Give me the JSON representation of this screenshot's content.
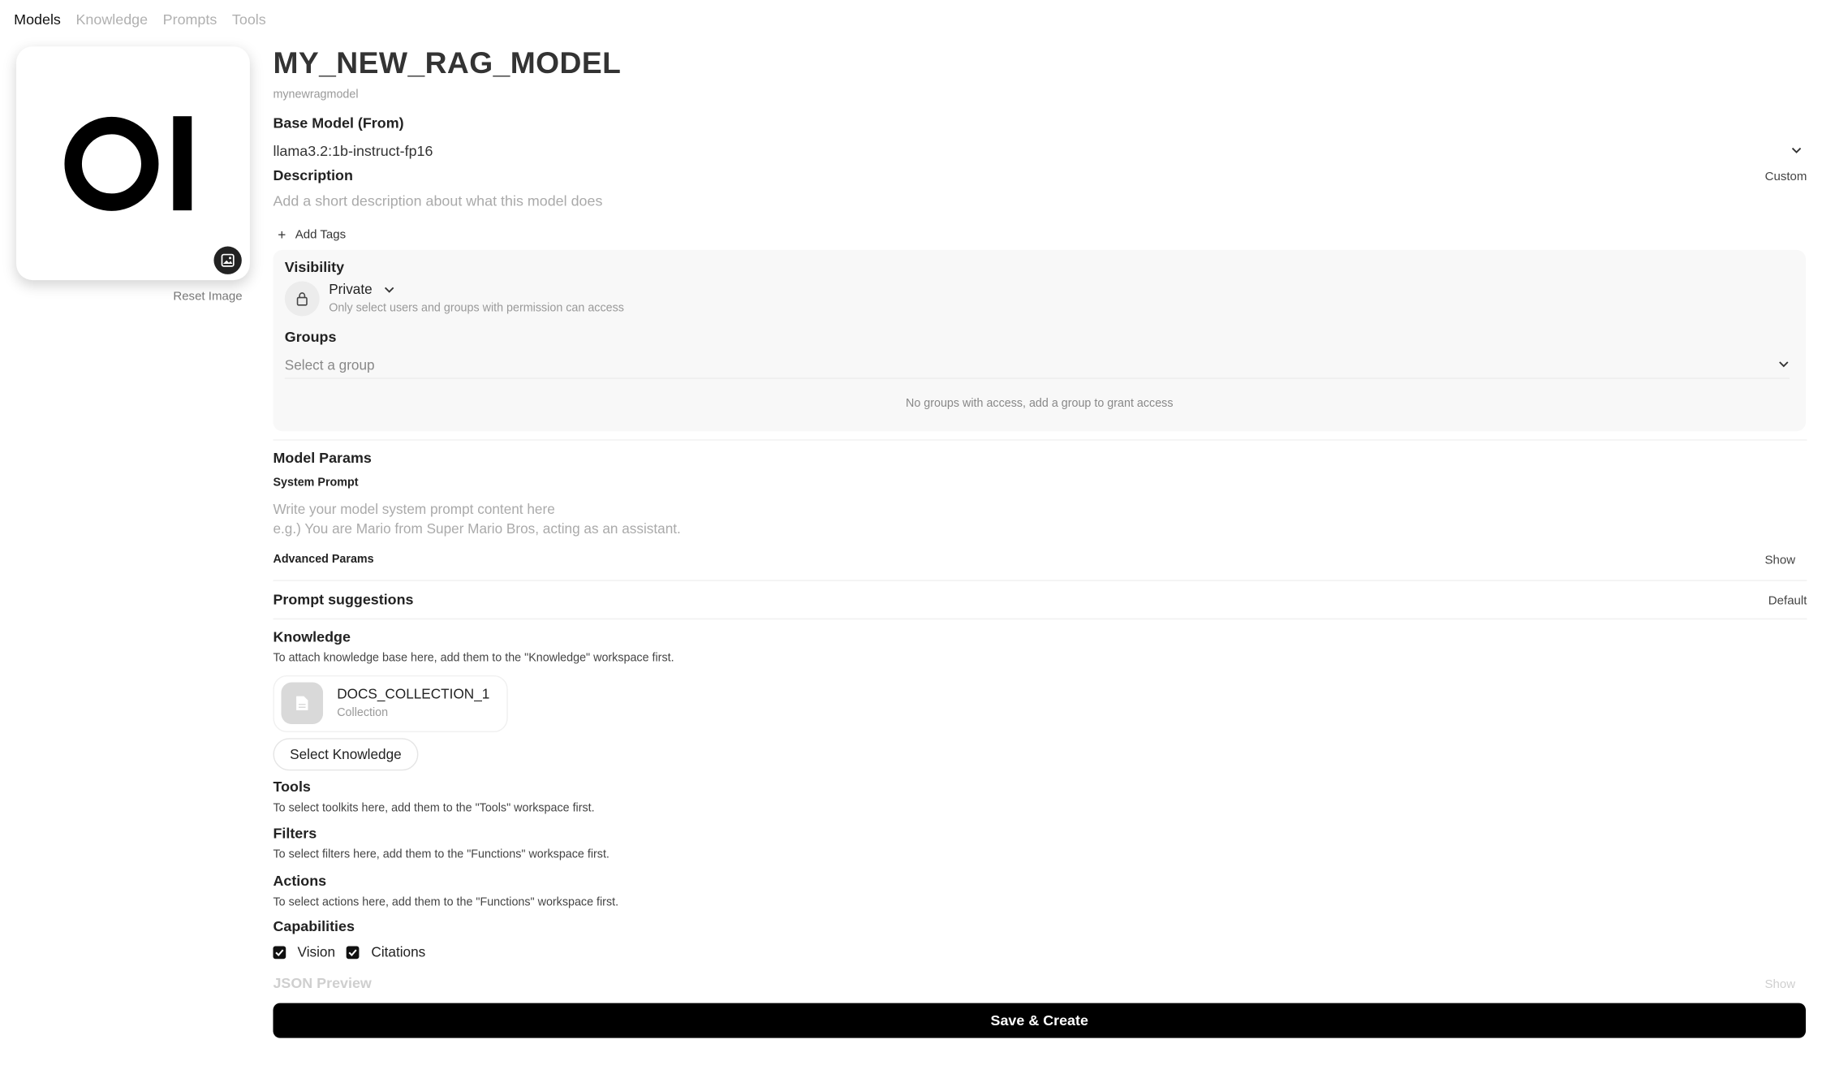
{
  "nav": {
    "tabs": [
      {
        "label": "Models",
        "active": true
      },
      {
        "label": "Knowledge",
        "active": false
      },
      {
        "label": "Prompts",
        "active": false
      },
      {
        "label": "Tools",
        "active": false
      }
    ]
  },
  "avatar": {
    "logo_text": "OI",
    "reset_label": "Reset Image"
  },
  "model": {
    "name": "MY_NEW_RAG_MODEL",
    "id": "mynewragmodel"
  },
  "base_model": {
    "label": "Base Model (From)",
    "value": "llama3.2:1b-instruct-fp16"
  },
  "description": {
    "label": "Description",
    "mode": "Custom",
    "placeholder": "Add a short description about what this model does"
  },
  "tags": {
    "add_label": "Add Tags"
  },
  "visibility": {
    "label": "Visibility",
    "value": "Private",
    "hint": "Only select users and groups with permission can access"
  },
  "groups": {
    "label": "Groups",
    "placeholder": "Select a group",
    "empty_text": "No groups with access, add a group to grant access"
  },
  "model_params": {
    "label": "Model Params",
    "system_prompt_label": "System Prompt",
    "system_prompt_placeholder_1": "Write your model system prompt content here",
    "system_prompt_placeholder_2": "e.g.) You are Mario from Super Mario Bros, acting as an assistant.",
    "advanced_label": "Advanced Params",
    "advanced_toggle": "Show"
  },
  "prompt_suggestions": {
    "label": "Prompt suggestions",
    "mode": "Default"
  },
  "knowledge": {
    "label": "Knowledge",
    "hint": "To attach knowledge base here, add them to the \"Knowledge\" workspace first.",
    "items": [
      {
        "name": "DOCS_COLLECTION_1",
        "type": "Collection"
      }
    ],
    "select_label": "Select Knowledge"
  },
  "tools": {
    "label": "Tools",
    "hint": "To select toolkits here, add them to the \"Tools\" workspace first."
  },
  "filters": {
    "label": "Filters",
    "hint": "To select filters here, add them to the \"Functions\" workspace first."
  },
  "actions": {
    "label": "Actions",
    "hint": "To select actions here, add them to the \"Functions\" workspace first."
  },
  "capabilities": {
    "label": "Capabilities",
    "items": [
      {
        "label": "Vision",
        "checked": true
      },
      {
        "label": "Citations",
        "checked": true
      }
    ]
  },
  "json_preview": {
    "label": "JSON Preview",
    "toggle": "Show"
  },
  "save": {
    "label": "Save & Create"
  }
}
